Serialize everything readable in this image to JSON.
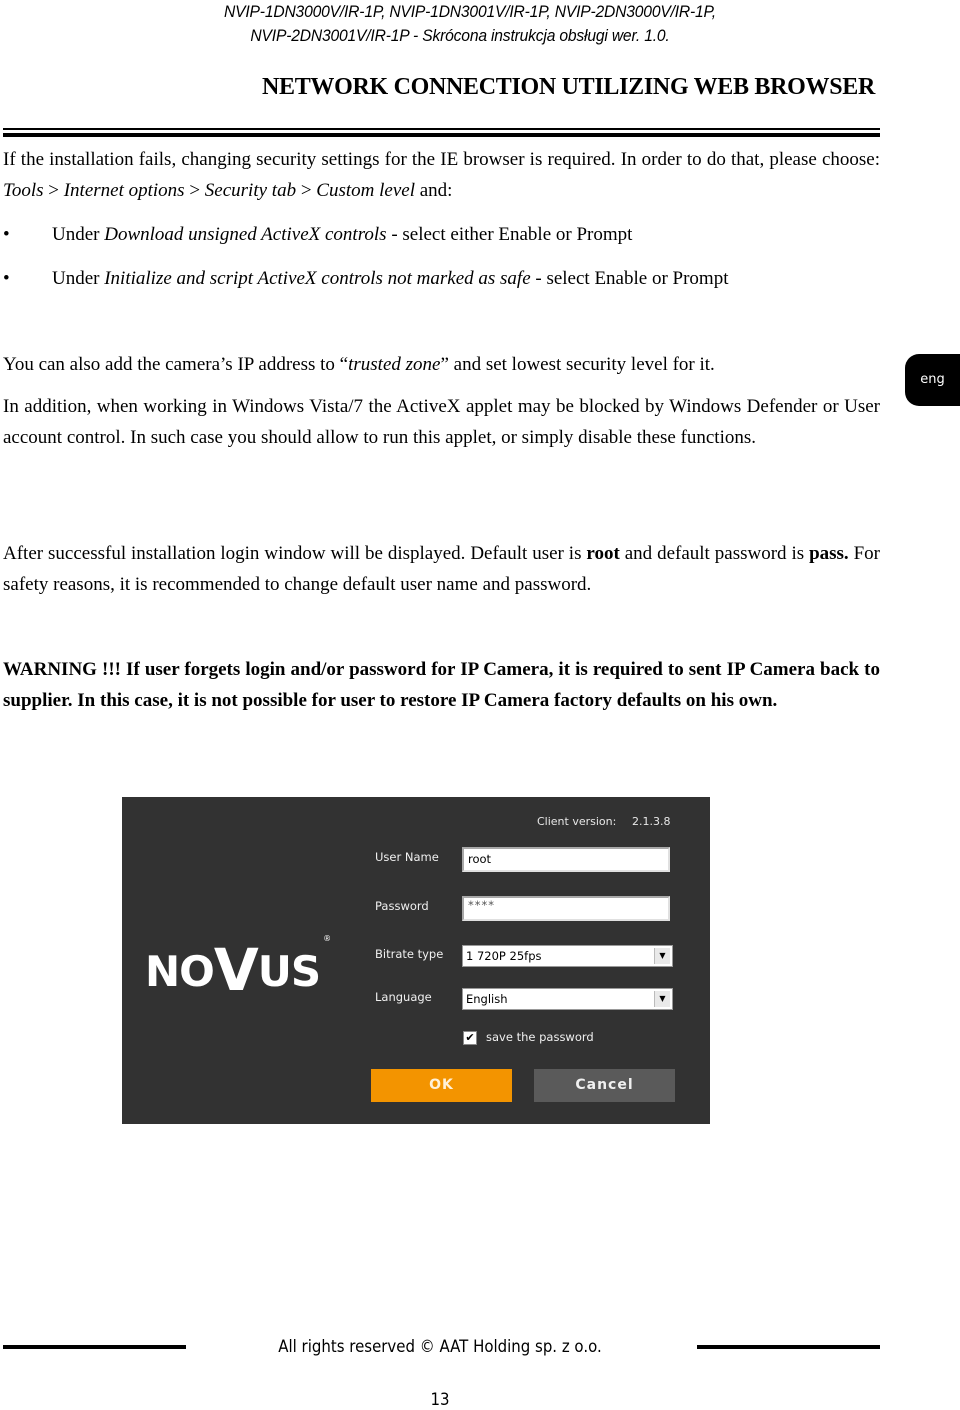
{
  "header": {
    "models_line1": "NVIP-1DN3000V/IR-1P, NVIP-1DN3001V/IR-1P, NVIP-2DN3000V/IR-1P,",
    "models_line2": "NVIP-2DN3001V/IR-1P - Skrócona instrukcja obsługi wer. 1.0.",
    "section_title": "NETWORK CONNECTION UTILIZING WEB BROWSER"
  },
  "language_tab": "eng",
  "content": {
    "p1": {
      "a": "If the installation fails, changing security settings for the IE browser is required. In order to do that, please choose: ",
      "tools": "Tools",
      "sep1": " > ",
      "internet_options": "Internet options",
      "sep2": " > ",
      "security_tab": "Security tab",
      "sep3": " > ",
      "custom_level": "Custom level",
      "end": " and:"
    },
    "bullets": [
      {
        "symbol": "•",
        "pre": "Under ",
        "italic": "Download unsigned ActiveX controls",
        "post": " - select either Enable or Prompt"
      },
      {
        "symbol": "•",
        "pre": "Under ",
        "italic": "Initialize and script ActiveX controls not marked as safe",
        "post": " - select Enable or Prompt"
      }
    ],
    "p2": {
      "pre": "You can also add the camera’s IP address to “",
      "italic": "trusted zone",
      "post": "” and set lowest security level for it."
    },
    "p3": "In addition, when working in Windows Vista/7 the ActiveX applet may be blocked by Windows Defender or User account control. In such case you should allow to run this applet, or simply disable these functions.",
    "p4": {
      "a": "After successful installation login window will be displayed. Default user is ",
      "user": "root",
      "b": " and default password is ",
      "password": "pass.",
      "c": " For safety reasons, it is recommended to change default user name and password."
    },
    "warning": "WARNING !!!  If user forgets login and/or password for IP Camera, it is required to sent IP Camera back to supplier. In this case, it is not possible for user to restore IP Camera factory defaults on his own."
  },
  "login_window": {
    "logo_text": {
      "a": "NO",
      "v": "V",
      "b": "US",
      "reg": "®"
    },
    "client_version_label": "Client version:",
    "client_version": "2.1.3.8",
    "user_name_label": "User Name",
    "user_name_value": "root",
    "password_label": "Password",
    "password_value": "****",
    "bitrate_label": "Bitrate type",
    "bitrate_value": "1 720P 25fps",
    "language_label": "Language",
    "language_value": "English",
    "save_password_label": "save the password",
    "save_password_checked": true,
    "ok_label": "OK",
    "cancel_label": "Cancel",
    "colors": {
      "background": "#323232",
      "ok": "#f39400",
      "cancel": "#5a5a5a"
    }
  },
  "footer": {
    "copyright": "All rights reserved © AAT Holding sp. z o.o.",
    "page_number": "13"
  }
}
